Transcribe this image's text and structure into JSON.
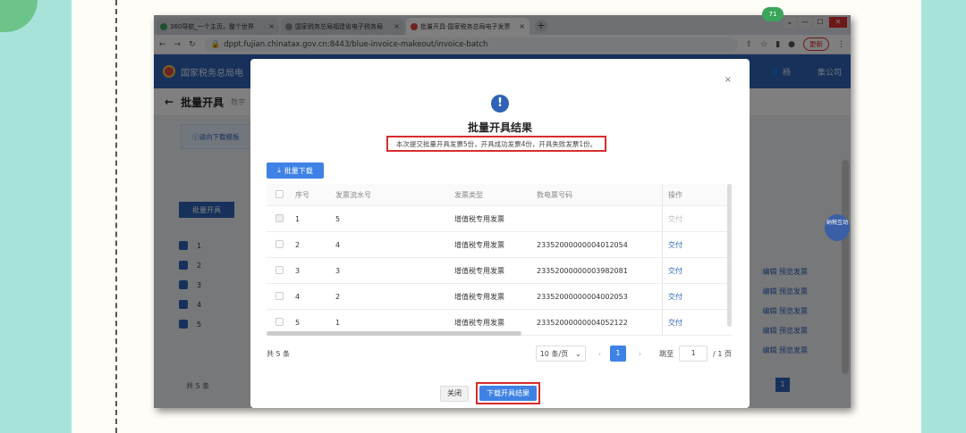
{
  "browser": {
    "tabs": [
      {
        "label": "360导航_一个主页，整个世界",
        "active": false
      },
      {
        "label": "国家税务总局福建省电子税务局",
        "active": false
      },
      {
        "label": "批量开具-国家税务总局电子发票",
        "active": true
      }
    ],
    "url": "dppt.fujian.chinatax.gov.cn:8443/blue-invoice-makeout/invoice-batch",
    "update_label": "更新",
    "badge": "71"
  },
  "site": {
    "org_name": "国家税务总局电",
    "user_name": "杨",
    "company": "集公司"
  },
  "page": {
    "title": "批量开具",
    "subtitle": "数字",
    "notice": "请向下载模板",
    "batch_btn": "批量开具",
    "total": "共 5 条",
    "bg_rows": [
      "1",
      "2",
      "3",
      "4",
      "5"
    ],
    "bg_links": [
      "编辑 预览发票",
      "编辑 预览发票",
      "编辑 预览发票",
      "编辑 预览发票",
      "编辑 预览发票"
    ],
    "page_num": "1"
  },
  "modal": {
    "title": "批量开具结果",
    "summary": "本次提交批量开具发票5份，开具成功发票4份，开具失败发票1份。",
    "download_all": "批量下载",
    "columns": [
      "序号",
      "发票流水号",
      "发票类型",
      "数电票号码",
      "操作"
    ],
    "rows": [
      {
        "idx": "1",
        "serial": "5",
        "type": "增值税专用发票",
        "number": "",
        "action": "交付",
        "disabled": true
      },
      {
        "idx": "2",
        "serial": "4",
        "type": "增值税专用发票",
        "number": "23352000000004012054",
        "action": "交付",
        "disabled": false
      },
      {
        "idx": "3",
        "serial": "3",
        "type": "增值税专用发票",
        "number": "23352000000003982081",
        "action": "交付",
        "disabled": false
      },
      {
        "idx": "4",
        "serial": "2",
        "type": "增值税专用发票",
        "number": "23352000000004002053",
        "action": "交付",
        "disabled": false
      },
      {
        "idx": "5",
        "serial": "1",
        "type": "增值税专用发票",
        "number": "23352000000004052122",
        "action": "交付",
        "disabled": false
      }
    ],
    "total": "共 5 条",
    "page_size": "10 条/页",
    "current_page": "1",
    "jump_label": "跳至",
    "jump_value": "1",
    "total_pages": "/ 1 页",
    "close_btn": "关闭",
    "download_result_btn": "下载开具结果"
  },
  "widget": "纳税互动"
}
